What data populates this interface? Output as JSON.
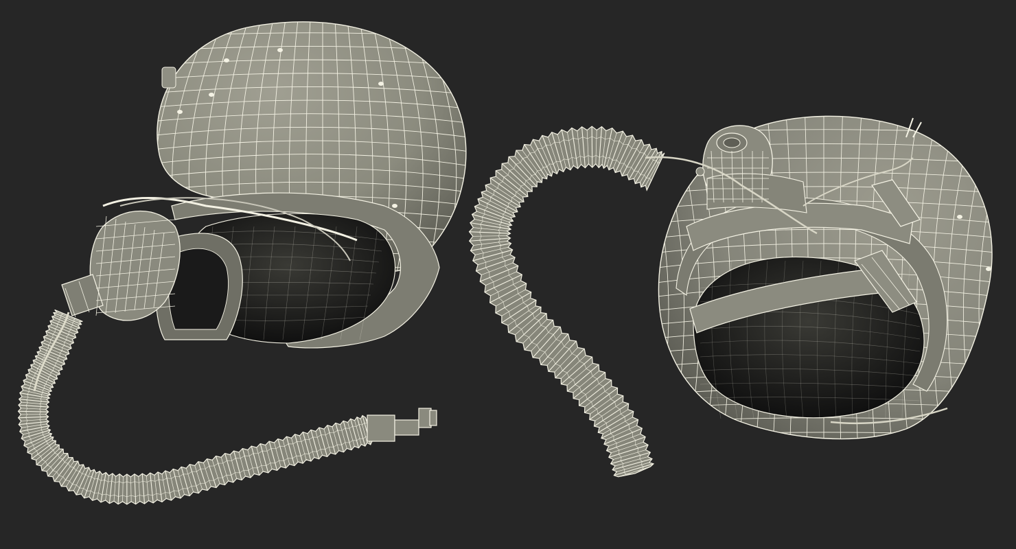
{
  "scene": {
    "background_color": "#262626",
    "mesh_fill": "#8b8b7e",
    "mesh_shade": "#5d5d54",
    "wire_color": "#f4f2e4",
    "interior_color": "#161616",
    "objects": [
      {
        "label": "helmet-with-oxygen-mask-side-view"
      },
      {
        "label": "helmet-with-oxygen-mask-rear-view"
      }
    ]
  }
}
